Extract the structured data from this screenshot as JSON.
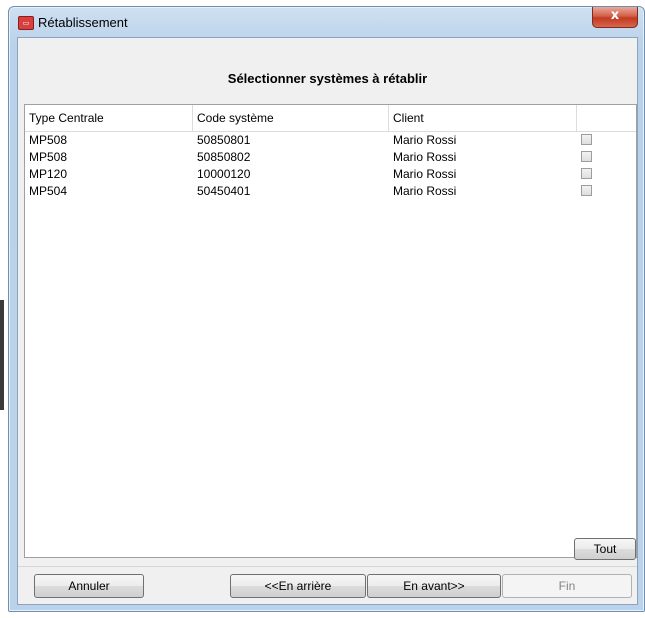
{
  "window": {
    "title": "Rétablissement",
    "close_label": "x"
  },
  "header": {
    "title": "Sélectionner systèmes à rétablir"
  },
  "grid": {
    "columns": [
      "Type Centrale",
      "Code système",
      "Client",
      ""
    ],
    "rows": [
      {
        "type": "MP508",
        "code": "50850801",
        "client": "Mario Rossi",
        "checked": false
      },
      {
        "type": "MP508",
        "code": "50850802",
        "client": "Mario Rossi",
        "checked": false
      },
      {
        "type": "MP120",
        "code": "10000120",
        "client": "Mario Rossi",
        "checked": false
      },
      {
        "type": "MP504",
        "code": "50450401",
        "client": "Mario Rossi",
        "checked": false
      }
    ]
  },
  "buttons": {
    "tout": "Tout",
    "annuler": "Annuler",
    "back": "<<En arrière",
    "next": "En avant>>",
    "fin": "Fin"
  },
  "colors": {
    "title_gradient": "#b9d1ea",
    "close_red": "#c23a22",
    "dialog_bg": "#f0f0f0"
  }
}
